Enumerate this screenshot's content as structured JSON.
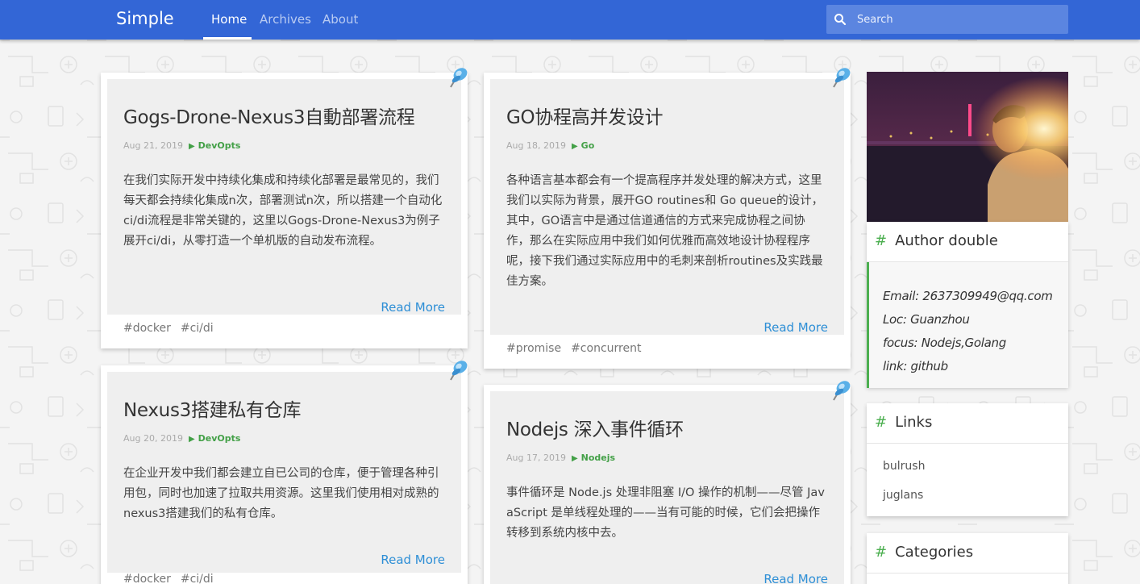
{
  "nav": {
    "brand": "Simple",
    "items": [
      {
        "label": "Home",
        "active": true
      },
      {
        "label": "Archives",
        "active": false
      },
      {
        "label": "About",
        "active": false
      }
    ],
    "search_placeholder": "Search"
  },
  "posts": [
    {
      "title": "Gogs-Drone-Nexus3自動部署流程",
      "date": "Aug 21, 2019",
      "category": "DevOpts",
      "excerpt": "在我们实际开发中持续化集成和持续化部署是最常见的，我们每天都会持续化集成n次，部署测试n次，所以搭建一个自动化ci/di流程是非常关键的，这里以Gogs-Drone-Nexus3为例子展开ci/di，从零打造一个单机版的自动发布流程。",
      "read_more": "Read More",
      "tags": [
        "#docker",
        "#ci/di"
      ]
    },
    {
      "title": "GO协程高并发设计",
      "date": "Aug 18, 2019",
      "category": "Go",
      "excerpt": "各种语言基本都会有一个提高程序并发处理的解决方式，这里我们以实际为背景，展开GO routines和 Go queue的设计，其中，GO语言中是通过信道通信的方式来完成协程之间协作，那么在实际应用中我们如何优雅而高效地设计协程程序呢，接下我们通过实际应用中的毛刺来剖析routines及实践最佳方案。",
      "read_more": "Read More",
      "tags": [
        "#promise",
        "#concurrent"
      ]
    },
    {
      "title": "Nexus3搭建私有仓库",
      "date": "Aug 20, 2019",
      "category": "DevOpts",
      "excerpt": "在企业开发中我们都会建立自已公司的仓库，便于管理各种引用包，同时也加速了拉取共用资源。这里我们使用相对成熟的nexus3搭建我们的私有仓库。",
      "read_more": "Read More",
      "tags": [
        "#docker",
        "#ci/di"
      ]
    },
    {
      "title": "Nodejs 深入事件循环",
      "date": "Aug 17, 2019",
      "category": "Nodejs",
      "excerpt": "事件循环是 Node.js 处理非阻塞 I/O 操作的机制——尽管 JavaScript 是单线程处理的——当有可能的时候，它们会把操作转移到系统内核中去。",
      "read_more": "Read More",
      "tags": []
    }
  ],
  "sidebar": {
    "author": {
      "heading": "Author double",
      "lines": [
        "Email: 2637309949@qq.com",
        "Loc: Guanzhou",
        "focus: Nodejs,Golang",
        "link: github"
      ]
    },
    "links": {
      "heading": "Links",
      "items": [
        "bulrush",
        "juglans"
      ]
    },
    "categories": {
      "heading": "Categories"
    }
  },
  "icons": {
    "pin": "pushpin-icon",
    "search": "search-icon",
    "hash": "#"
  },
  "colors": {
    "nav_bg": "#3366d6",
    "accent_green": "#43a047",
    "link_blue": "#2e8fd6"
  }
}
